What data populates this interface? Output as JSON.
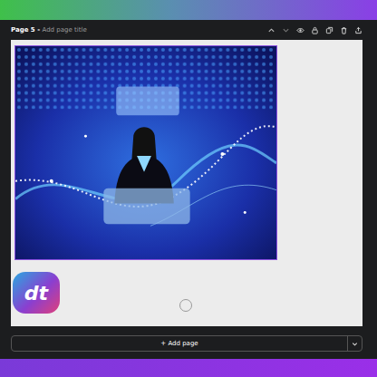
{
  "page": {
    "label": "Page 5 - ",
    "title_placeholder": "Add page title"
  },
  "logo": {
    "text": "dt"
  },
  "add_page": {
    "label": "+ Add page"
  }
}
